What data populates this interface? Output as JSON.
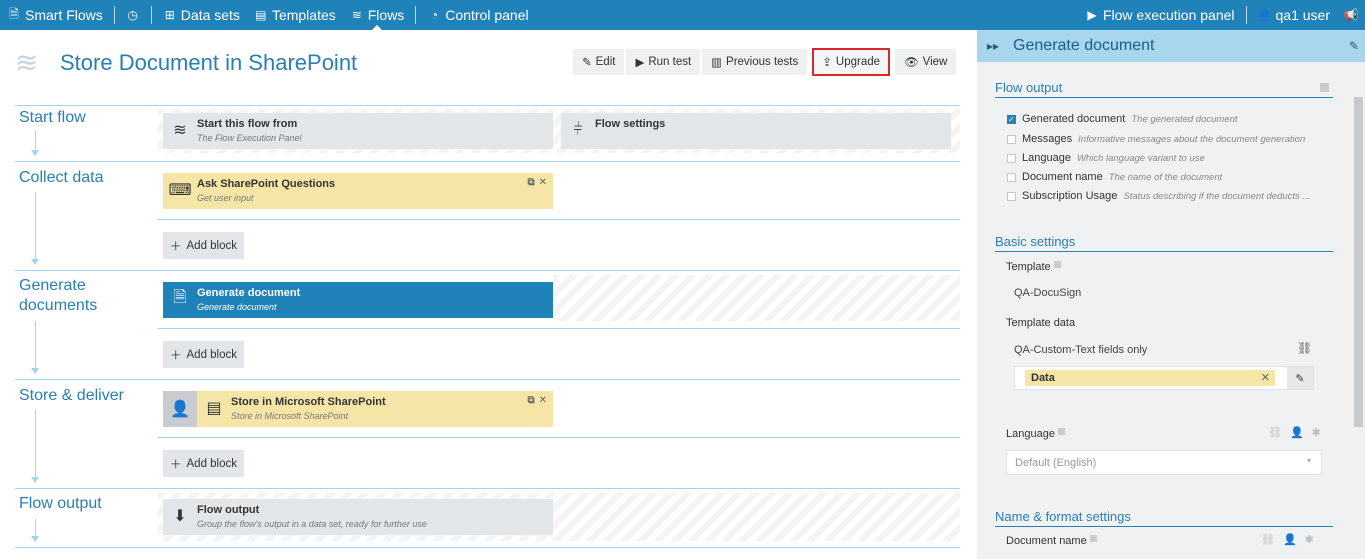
{
  "nav": {
    "brand": "Smart Flows",
    "items": [
      {
        "label": "Data sets"
      },
      {
        "label": "Templates"
      },
      {
        "label": "Flows"
      },
      {
        "label": "Control panel"
      }
    ],
    "right": {
      "execution_panel": "Flow execution panel",
      "user": "qa1 user"
    }
  },
  "flow": {
    "title": "Store Document in SharePoint",
    "actions": {
      "edit": "Edit",
      "run_test": "Run test",
      "previous_tests": "Previous tests",
      "upgrade": "Upgrade",
      "view": "View"
    }
  },
  "sections": {
    "start": {
      "label": "Start flow",
      "blocks": [
        {
          "title": "Start this flow from",
          "subtitle": "The Flow Execution Panel"
        },
        {
          "title": "Flow settings",
          "subtitle": ""
        }
      ]
    },
    "collect": {
      "label": "Collect data",
      "block": {
        "title": "Ask SharePoint Questions",
        "subtitle": "Get user input"
      },
      "add": "Add block"
    },
    "generate": {
      "label_line1": "Generate",
      "label_line2": "documents",
      "block": {
        "title": "Generate document",
        "subtitle": "Generate document"
      },
      "add": "Add block"
    },
    "store": {
      "label": "Store & deliver",
      "block": {
        "title": "Store in Microsoft SharePoint",
        "subtitle": "Store in Microsoft SharePoint"
      },
      "add": "Add block"
    },
    "output": {
      "label": "Flow output",
      "block": {
        "title": "Flow output",
        "subtitle": "Group the flow's output in a data set, ready for further use"
      }
    }
  },
  "panel": {
    "title": "Generate document",
    "flow_output": {
      "heading": "Flow output",
      "items": [
        {
          "label": "Generated document",
          "desc": "The generated document",
          "checked": true
        },
        {
          "label": "Messages",
          "desc": "Informative messages about the document generation",
          "checked": false
        },
        {
          "label": "Language",
          "desc": "Which language variant to use",
          "checked": false
        },
        {
          "label": "Document name",
          "desc": "The name of the document",
          "checked": false
        },
        {
          "label": "Subscription Usage",
          "desc": "Status describing if the document deducts ...",
          "checked": false
        }
      ]
    },
    "basic": {
      "heading": "Basic settings",
      "template_label": "Template",
      "template_value": "QA-DocuSign",
      "template_data_label": "Template data",
      "template_data_value": "QA-Custom-Text fields only",
      "tag": "Data",
      "language_label": "Language",
      "language_value": "Default (English)"
    },
    "name_format": {
      "heading": "Name & format settings",
      "document_name_label": "Document name"
    }
  },
  "colors": {
    "topbar": "#1f82b8",
    "accent": "#2a7fb3",
    "block_yellow": "#f5e6a8",
    "block_blue": "#1f82b8",
    "highlight": "#d62a2a"
  }
}
